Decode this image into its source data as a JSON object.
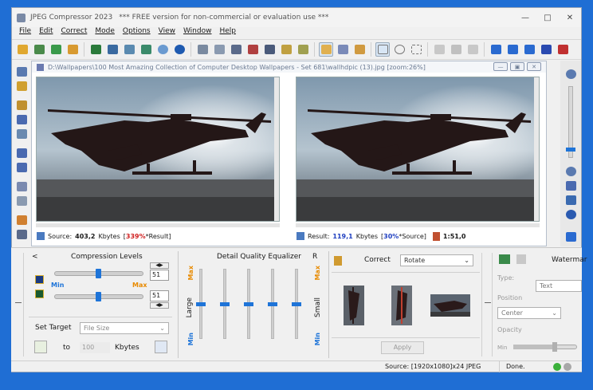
{
  "app": {
    "title": "JPEG Compressor 2023",
    "subtitle": "*** FREE version for non-commercial or evaluation use ***"
  },
  "menu": [
    "File",
    "Edit",
    "Correct",
    "Mode",
    "Options",
    "View",
    "Window",
    "Help"
  ],
  "document": {
    "title": "D:\\Wallpapers\\100 Most Amazing Collection of Computer Desktop Wallpapers - Set 681\\wallhdpic (13).jpg [zoom:26%]",
    "source_label": "Source:",
    "source_size": "403,2",
    "source_unit": "Kbytes",
    "source_ratio": "339%",
    "source_ref": "*Result",
    "result_label": "Result:",
    "result_size": "119,1",
    "result_unit": "Kbytes",
    "result_ratio": "30%",
    "result_ref": "*Source",
    "compression_ratio": "1:51,0"
  },
  "compression": {
    "header_arrow": "<",
    "title": "Compression Levels",
    "value1": "51",
    "value2": "51",
    "min_label": "Min",
    "max_label": "Max",
    "level1": 0.48,
    "level2": 0.48,
    "set_target_label": "Set Target",
    "target_type": "File Size",
    "to_label": "to",
    "target_value": "100",
    "target_unit": "Kbytes"
  },
  "equalizer": {
    "title": "Detail Quality Equalizer",
    "r_label": "R",
    "large_label": "Large",
    "small_label": "Small",
    "max_label": "Max",
    "min_label": "Min",
    "levels": [
      0.5,
      0.5,
      0.5,
      0.5,
      0.5
    ]
  },
  "correct": {
    "title": "Correct",
    "mode": "Rotate",
    "apply_label": "Apply"
  },
  "watermark": {
    "title": "Watermar",
    "type_label": "Type:",
    "type_value": "Text",
    "position_label": "Position",
    "position_value": "Center",
    "opacity_label": "Opacity",
    "opacity_min": "Min"
  },
  "status": {
    "source_info": "Source: [1920x1080]x24 JPEG",
    "state": "Done."
  },
  "colors": {
    "accent": "#1e74d8",
    "max_orange": "#e88a00",
    "ratio_red": "#d02020",
    "ratio_blue": "#2040c0"
  }
}
